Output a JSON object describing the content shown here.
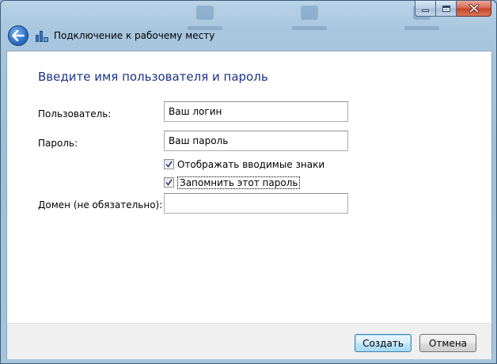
{
  "window": {
    "title": "Подключение к рабочему месту"
  },
  "form": {
    "heading": "Введите имя пользователя и пароль",
    "username_label": "Пользователь:",
    "username_value": "Ваш логин",
    "password_label": "Пароль:",
    "password_value": "Ваш пароль",
    "show_chars_label": "Отображать вводимые знаки",
    "show_chars_checked": true,
    "remember_label": "Запомнить этот пароль",
    "remember_checked": true,
    "domain_label": "Домен (не обязательно):",
    "domain_value": ""
  },
  "footer": {
    "create_label": "Создать",
    "cancel_label": "Отмена"
  },
  "icons": {
    "back": "back-arrow-icon",
    "title": "network-connection-icon",
    "minimize": "minimize-icon",
    "maximize": "maximize-icon",
    "close": "close-icon",
    "check": "checkmark-icon"
  },
  "colors": {
    "heading": "#1e3287",
    "frame": "#a9c6de",
    "close_button": "#c7452a",
    "default_button_border": "#3c7fb1"
  }
}
